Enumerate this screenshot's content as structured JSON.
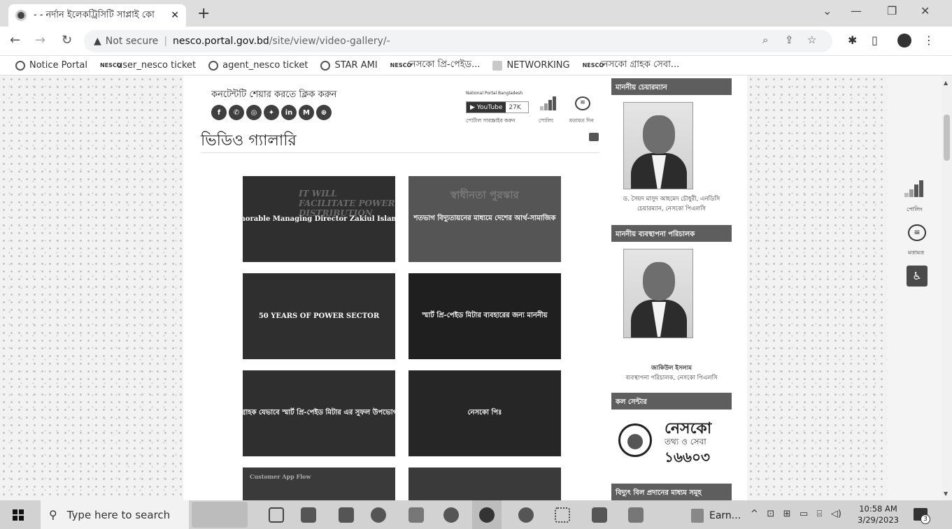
{
  "browser": {
    "tab_title": "- - নর্দান ইলেকট্রিসিটি সাপ্লাই কো",
    "tab_close": "✕",
    "new_tab": "+",
    "security_label": "Not secure",
    "url_host": "nesco.portal.gov.bd",
    "url_path": "/site/view/video-gallery/-",
    "bookmarks": [
      {
        "icon": "notice-icon",
        "label": "Notice Portal"
      },
      {
        "icon": "nesco-logo-icon",
        "label": "user_nesco ticket"
      },
      {
        "icon": "globe-icon",
        "label": "agent_nesco ticket"
      },
      {
        "icon": "globe-icon",
        "label": "STAR AMI"
      },
      {
        "icon": "nesco-logo-icon",
        "label": "নেসকো প্রি-পেইড..."
      },
      {
        "icon": "folder-icon",
        "label": "NETWORKING"
      },
      {
        "icon": "nesco-logo-icon",
        "label": "নেসকো গ্রাহক সেবা..."
      }
    ]
  },
  "page": {
    "share_label": "কনটেন্টটি শেয়ার করতে ক্লিক করুন",
    "social_icons": [
      "facebook-icon",
      "messenger-icon",
      "whatsapp-icon",
      "twitter-icon",
      "linkedin-icon",
      "email-icon",
      "share-icon"
    ],
    "social_glyphs": [
      "f",
      "✆",
      "◎",
      "✦",
      "in",
      "M",
      "⊕"
    ],
    "national_portal_label": "National Portal Bangladesh",
    "youtube_label": "YouTube",
    "youtube_count": "27K",
    "portal_subscribe_label": "পোর্টাল সাবস্ক্রাইব করুন",
    "poll_label": "পোলিং",
    "feedback_label": "মতামত দিন",
    "title": "ভিডিও গ্যালারি",
    "videos": [
      {
        "caption": "Honorable Managing Director Zakiul Islam of",
        "bg_text": "IT WILL FACILITATE POWER DISTRIBUTION"
      },
      {
        "caption": "শতভাগ বিদ্যুতায়নের মাধ্যমে দেশের আর্থ-সামাজিক",
        "bg_text": "স্বাধীনতা পুরস্কার"
      },
      {
        "caption": "50 YEARS OF POWER SECTOR",
        "bg_text": ""
      },
      {
        "caption": "স্মার্ট প্রি-পেইড মিটার ব্যবহারের জন্য মাননীয়",
        "bg_text": ""
      },
      {
        "caption": "গ্রাহক যেভাবে স্মার্ট প্রি-পেইড মিটার এর সুফল উপভোগ",
        "bg_text": ""
      },
      {
        "caption": "নেসকো পিঃ",
        "bg_text": ""
      },
      {
        "caption": "",
        "bg_text": "Customer App Flow"
      },
      {
        "caption": "",
        "bg_text": ""
      }
    ]
  },
  "sidebar": {
    "chairman_heading": "মাননীয় চেয়ারম্যান",
    "chairman_name": "ড. সৈয়দ মাসুদ আহমেদ চৌধুরী, এনডিসি",
    "chairman_role": "চেয়ারম্যান, নেসকো পিএলসি",
    "md_heading": "মাননীয় ব্যবস্থাপনা পরিচালক",
    "md_name": "জাকিউল ইসলাম",
    "md_role": "ব্যবস্থাপনা পরিচালক, নেসকো পিএলসি",
    "call_center_heading": "কল সেন্টার",
    "call_center_title": "নেসকো",
    "call_center_sub": "তথ্য ও সেবা",
    "call_center_number": "১৬৬০৩",
    "bill_heading": "বিদ্যুৎ বিল প্রদানের মাধ্যম সমূহ"
  },
  "floating": {
    "poll_label": "পোলিং",
    "feedback_label": "মতামত"
  },
  "taskbar": {
    "search_placeholder": "Type here to search",
    "earn_label": "Earn...",
    "time": "10:58 AM",
    "date": "3/29/2023",
    "notification_count": "3"
  }
}
